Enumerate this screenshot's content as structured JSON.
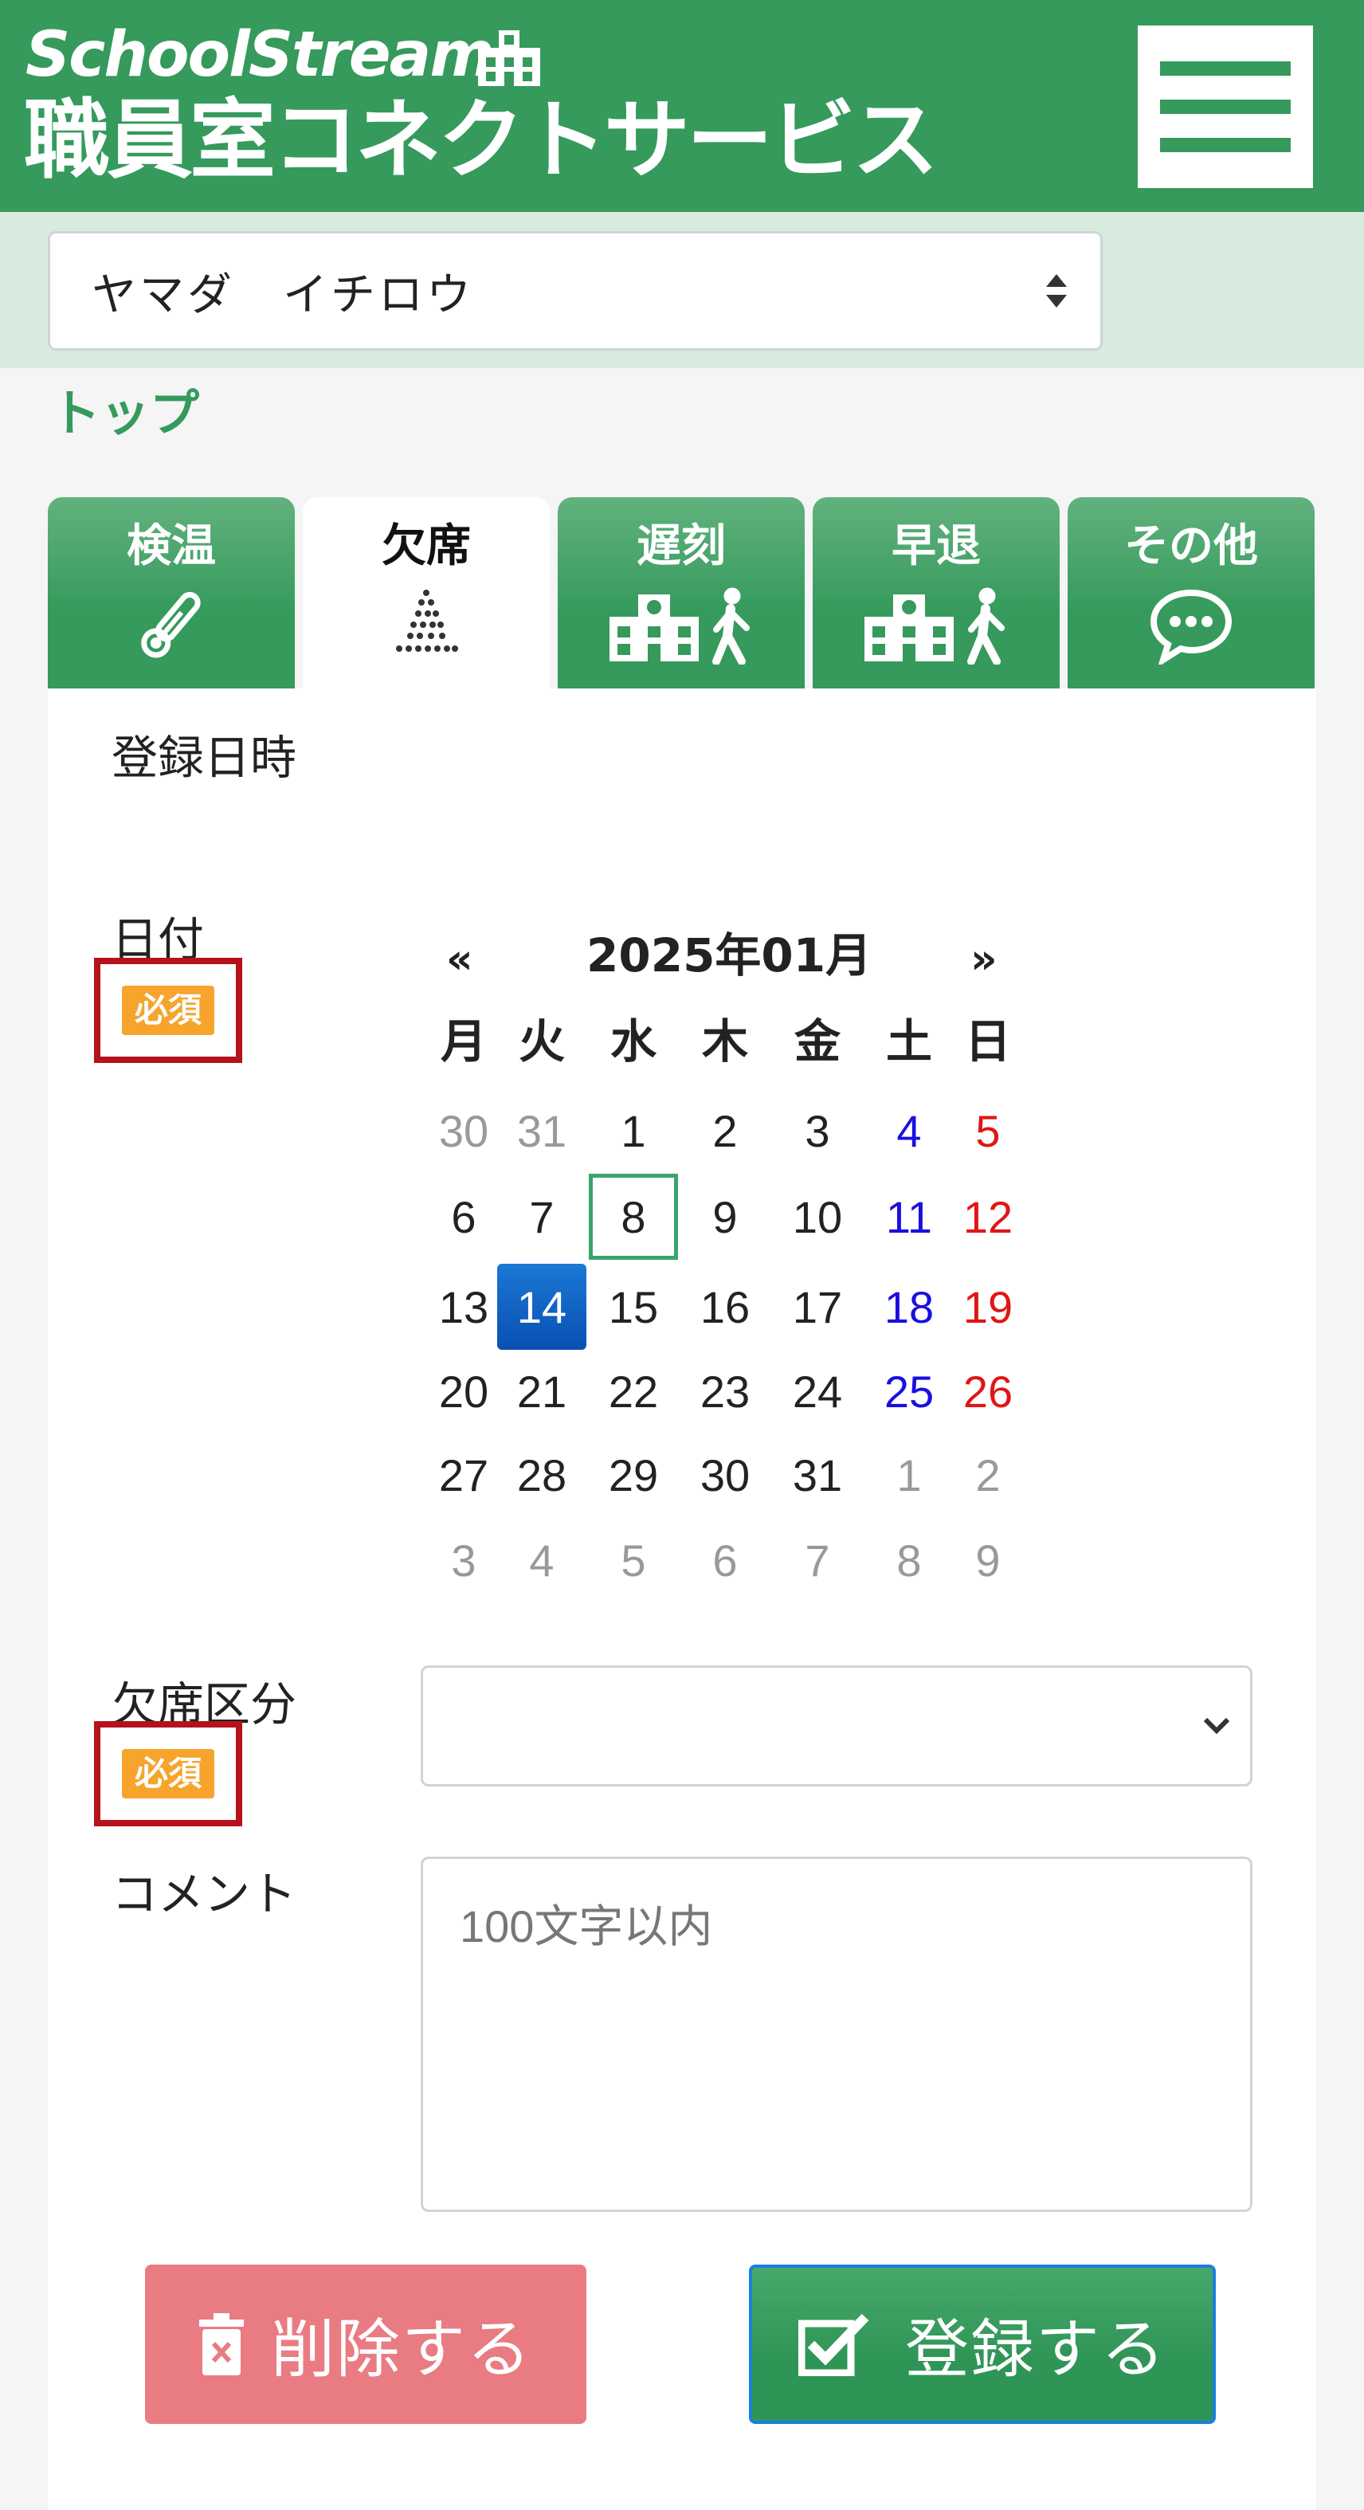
{
  "header": {
    "logo_top": "SchoolStream",
    "logo_bottom": "職員室コネクトサービス",
    "menu_icon": "hamburger-icon",
    "colors": {
      "brand": "#359a5c",
      "strip": "#d7ebde"
    }
  },
  "user_select": {
    "selected": "ヤマダ　イチロウ"
  },
  "breadcrumb": {
    "label": "トップ"
  },
  "tabs": [
    {
      "label": "検温",
      "icon": "thermometer-icon",
      "active": false
    },
    {
      "label": "欠席",
      "icon": "dots-pattern-icon",
      "active": true
    },
    {
      "label": "遅刻",
      "icon": "school-walker-icon",
      "active": false
    },
    {
      "label": "早退",
      "icon": "school-walker-icon",
      "active": false
    },
    {
      "label": "その他",
      "icon": "speech-bubble-icon",
      "active": false
    }
  ],
  "form": {
    "registered_label": "登録日時",
    "date_label": "日付",
    "required": "必須",
    "absence_label": "欠席区分",
    "absence_value": "",
    "comment_label": "コメント",
    "comment_placeholder": "100文字以内"
  },
  "calendar": {
    "prev": "«",
    "next": "»",
    "title": "2025年01月",
    "weekdays": [
      "月",
      "火",
      "水",
      "木",
      "金",
      "土",
      "日"
    ],
    "weeks": [
      [
        "30",
        "31",
        "1",
        "2",
        "3",
        "4",
        "5"
      ],
      [
        "6",
        "7",
        "8",
        "9",
        "10",
        "11",
        "12"
      ],
      [
        "13",
        "14",
        "15",
        "16",
        "17",
        "18",
        "19"
      ],
      [
        "20",
        "21",
        "22",
        "23",
        "24",
        "25",
        "26"
      ],
      [
        "27",
        "28",
        "29",
        "30",
        "31",
        "1",
        "2"
      ],
      [
        "3",
        "4",
        "5",
        "6",
        "7",
        "8",
        "9"
      ]
    ],
    "selected_day": "14",
    "today_day": "8",
    "colors": {
      "saturday": "#1a0fe0",
      "sunday": "#e01616",
      "other_month": "#999999",
      "selected": "#0a4fb4",
      "today_border": "#3aa56a"
    }
  },
  "buttons": {
    "delete_label": "削除する",
    "delete_icon": "trash-icon",
    "submit_label": "登録する",
    "submit_icon": "checkbox-icon",
    "colors": {
      "delete": "#e97b83",
      "submit": "#359a5c"
    }
  }
}
